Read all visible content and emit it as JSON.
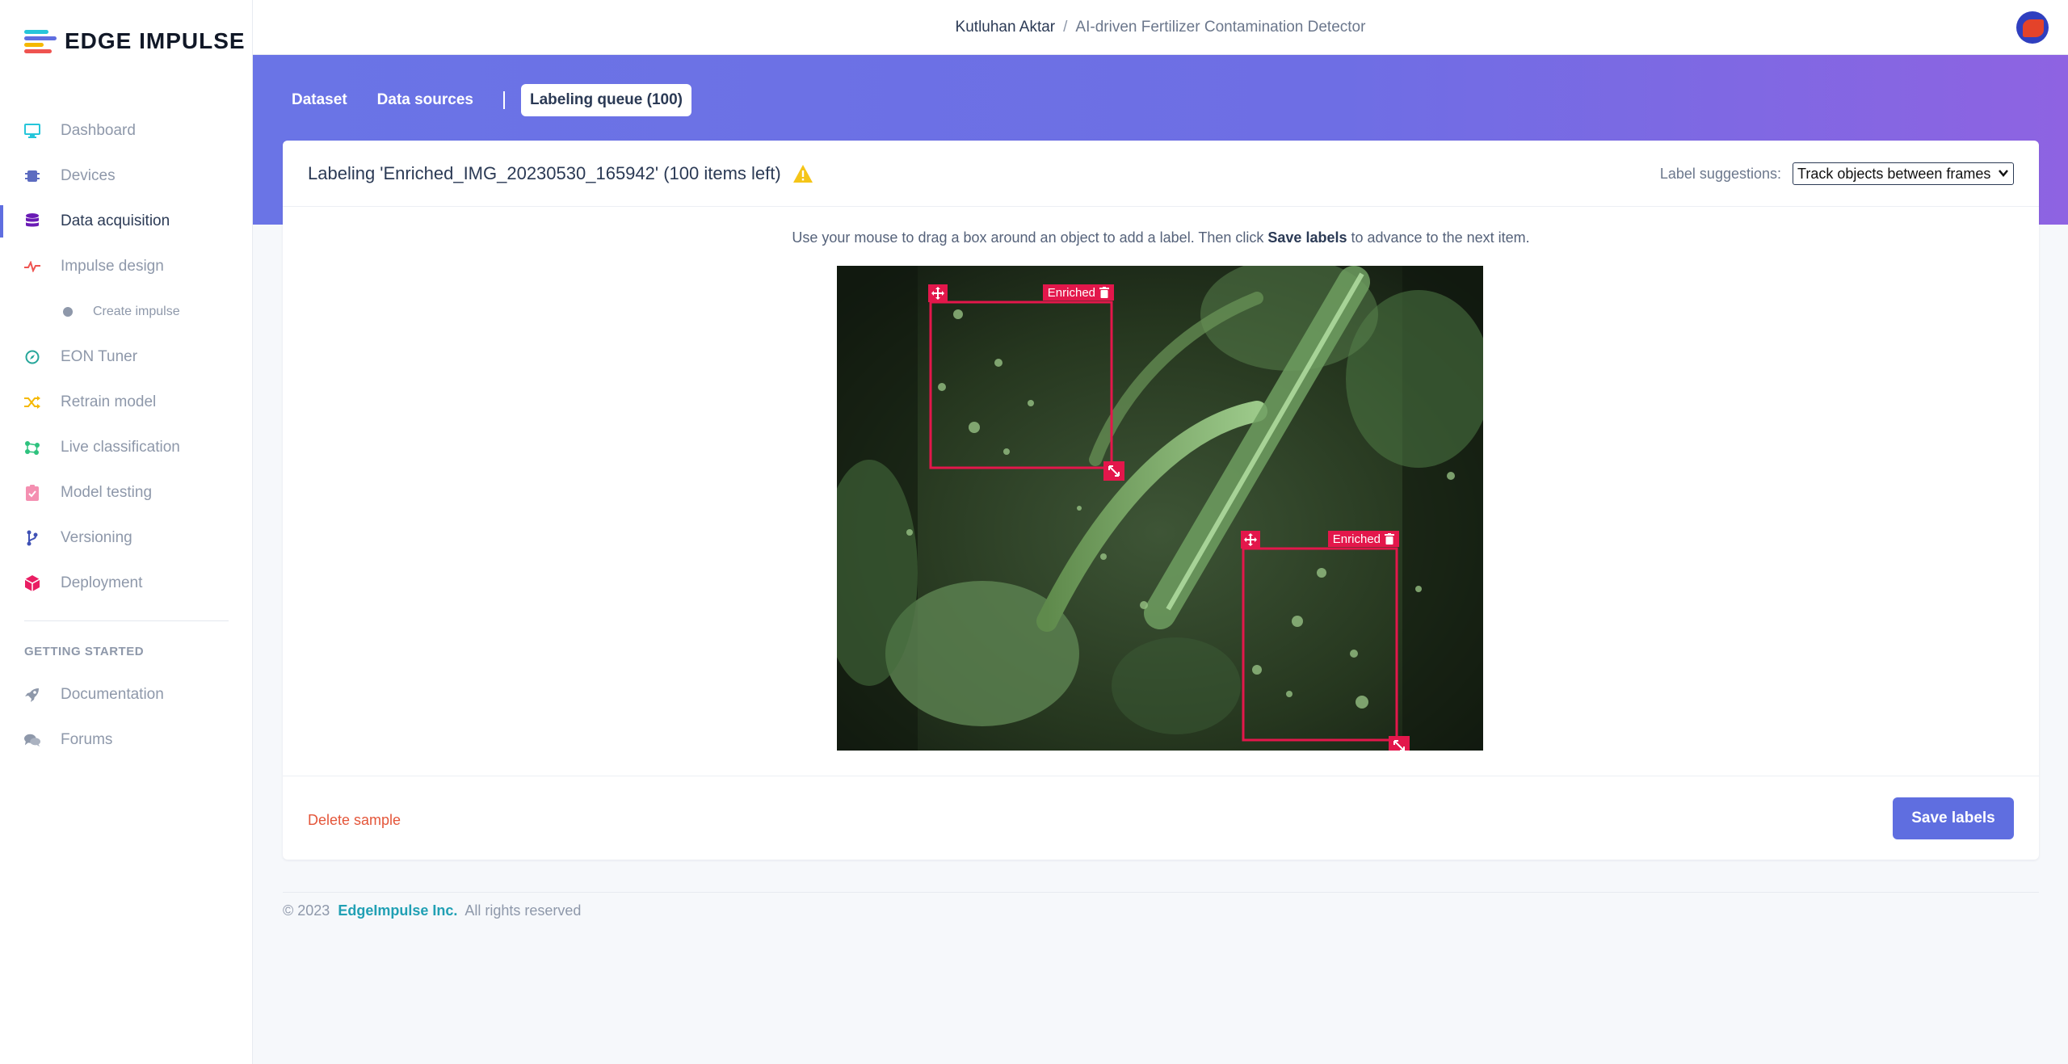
{
  "brand": {
    "name": "EDGE IMPULSE"
  },
  "sidebar": {
    "items": [
      {
        "label": "Dashboard",
        "icon": "monitor-icon",
        "color": "#26c6da"
      },
      {
        "label": "Devices",
        "icon": "chip-icon",
        "color": "#5c6bc0"
      },
      {
        "label": "Data acquisition",
        "icon": "database-icon",
        "color": "#6a1bb5",
        "active": true
      },
      {
        "label": "Impulse design",
        "icon": "pulse-icon",
        "color": "#ef5350"
      },
      {
        "label": "Create impulse",
        "icon": "dot-icon",
        "sub": true
      },
      {
        "label": "EON Tuner",
        "icon": "compass-icon",
        "color": "#26a69a"
      },
      {
        "label": "Retrain model",
        "icon": "shuffle-icon",
        "color": "#f5b800"
      },
      {
        "label": "Live classification",
        "icon": "network-icon",
        "color": "#2ec27e"
      },
      {
        "label": "Model testing",
        "icon": "clipboard-check-icon",
        "color": "#f48fb1"
      },
      {
        "label": "Versioning",
        "icon": "branch-icon",
        "color": "#3f51b5"
      },
      {
        "label": "Deployment",
        "icon": "cube-icon",
        "color": "#e91e63"
      }
    ],
    "section_title": "GETTING STARTED",
    "getting_started": [
      {
        "label": "Documentation",
        "icon": "rocket-icon"
      },
      {
        "label": "Forums",
        "icon": "chat-icon"
      }
    ]
  },
  "topbar": {
    "user": "Kutluhan Aktar",
    "separator": "/",
    "project": "AI-driven Fertilizer Contamination Detector"
  },
  "tabs": [
    {
      "label": "Dataset"
    },
    {
      "label": "Data sources"
    },
    {
      "label": "Labeling queue (100)",
      "active": true
    }
  ],
  "card": {
    "title": "Labeling 'Enriched_IMG_20230530_165942' (100 items left)",
    "suggestions_label": "Label suggestions:",
    "suggestions_value": "Track objects between frames",
    "hint_before": "Use your mouse to drag a box around an object to add a label. Then click ",
    "hint_bold": "Save labels",
    "hint_after": " to advance to the next item.",
    "boxes": [
      {
        "label": "Enriched"
      },
      {
        "label": "Enriched"
      }
    ],
    "delete_label": "Delete sample",
    "save_label": "Save labels"
  },
  "footer": {
    "copyright": "© 2023",
    "company": "EdgeImpulse Inc.",
    "rights": "All rights reserved"
  }
}
